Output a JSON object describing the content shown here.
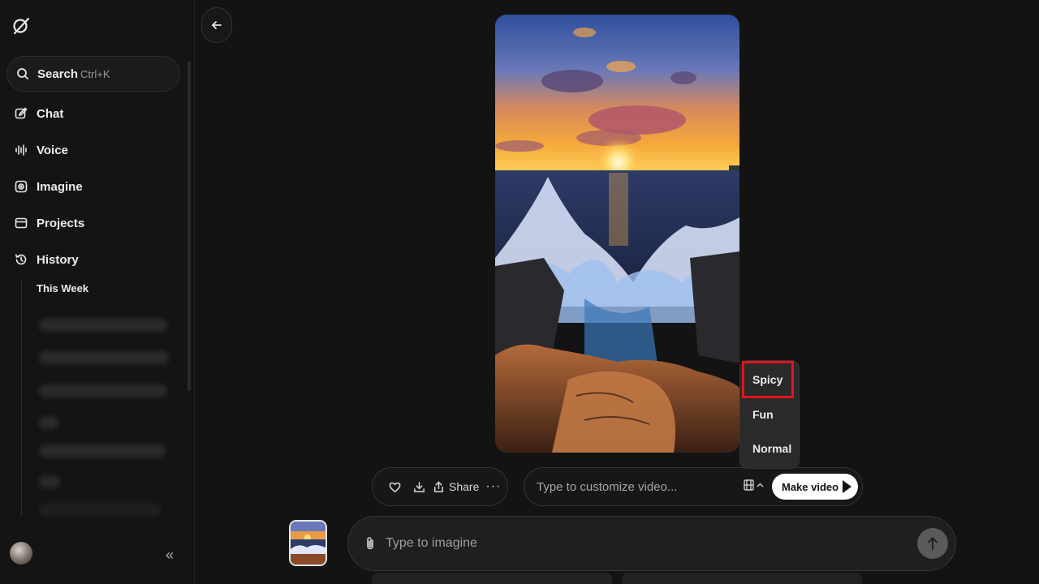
{
  "sidebar": {
    "search": {
      "label": "Search",
      "shortcut": "Ctrl+K"
    },
    "items": [
      {
        "label": "Chat",
        "icon": "chat-edit-icon"
      },
      {
        "label": "Voice",
        "icon": "waveform-icon"
      },
      {
        "label": "Imagine",
        "icon": "imagine-icon"
      },
      {
        "label": "Projects",
        "icon": "folder-icon"
      },
      {
        "label": "History",
        "icon": "history-icon"
      }
    ],
    "history_section": "This Week",
    "collapse_icon": "double-chevron-left-icon"
  },
  "image": {
    "description_icon": "generated-image-sunset-waves"
  },
  "action_bar": {
    "share_label": "Share"
  },
  "customize": {
    "placeholder": "Type to customize video...",
    "make_video_label": "Make video"
  },
  "mode_dropdown": {
    "options": [
      "Spicy",
      "Fun",
      "Normal"
    ],
    "highlighted": "Spicy",
    "highlight_color": "#e0141c"
  },
  "composer": {
    "placeholder": "Type to imagine"
  }
}
